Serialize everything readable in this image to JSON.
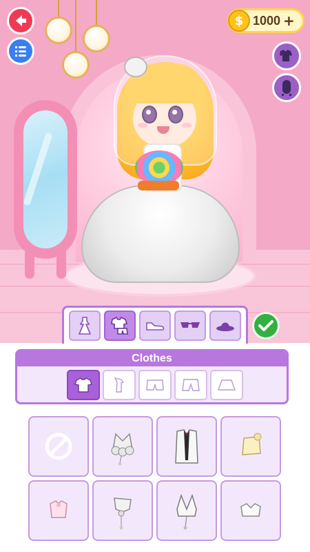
{
  "currency": {
    "amount": "1000",
    "plus": "+",
    "coin_glyph": "$"
  },
  "colors": {
    "accent": "#b777de",
    "accent_dark": "#a961d9",
    "back_button": "#ef3a55",
    "menu_button": "#3a7ef0",
    "confirm": "#34b043",
    "coin": "#ffc21a"
  },
  "top_buttons": [
    {
      "name": "back",
      "icon": "arrow-left-icon"
    },
    {
      "name": "menu",
      "icon": "list-icon"
    }
  ],
  "side_buttons": [
    {
      "name": "outfit",
      "icon": "outfit-icon"
    },
    {
      "name": "background",
      "icon": "mirror-icon"
    }
  ],
  "category_tabs": [
    {
      "name": "dress",
      "icon": "dress-icon",
      "active": false
    },
    {
      "name": "clothes",
      "icon": "clothes-icon",
      "active": true
    },
    {
      "name": "shoes",
      "icon": "shoe-icon",
      "active": false
    },
    {
      "name": "glasses",
      "icon": "glasses-icon",
      "active": false
    },
    {
      "name": "hat",
      "icon": "hat-icon",
      "active": false
    }
  ],
  "panel": {
    "title": "Clothes",
    "sub_tabs": [
      {
        "name": "shirt",
        "icon": "shirt-icon",
        "active": true
      },
      {
        "name": "top",
        "icon": "top-icon",
        "active": false
      },
      {
        "name": "shorts",
        "icon": "shorts-icon",
        "active": false
      },
      {
        "name": "pants",
        "icon": "pants-icon",
        "active": false
      },
      {
        "name": "skirt",
        "icon": "skirt-icon",
        "active": false
      }
    ]
  },
  "items": [
    {
      "name": "none",
      "icon": "no-icon"
    },
    {
      "name": "lace-bodice",
      "icon": "lace-bodice-icon"
    },
    {
      "name": "tuxedo-jacket",
      "icon": "tuxedo-icon"
    },
    {
      "name": "cream-top",
      "icon": "cream-top-icon"
    },
    {
      "name": "pink-top",
      "icon": "pink-top-icon"
    },
    {
      "name": "halter-top",
      "icon": "halter-top-icon"
    },
    {
      "name": "white-halter",
      "icon": "white-halter-icon"
    },
    {
      "name": "white-crop",
      "icon": "white-crop-icon"
    }
  ]
}
